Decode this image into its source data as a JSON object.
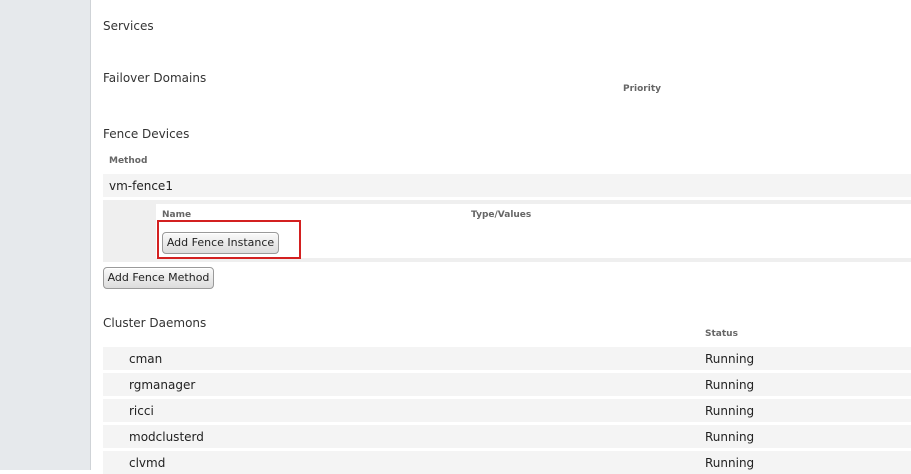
{
  "sections": {
    "services": "Services",
    "failover_domains": "Failover Domains",
    "failover_priority_header": "Priority",
    "fence_devices": "Fence Devices",
    "cluster_daemons": "Cluster Daemons"
  },
  "fence": {
    "method_header": "Method",
    "method_name": "vm-fence1",
    "name_header": "Name",
    "type_values_header": "Type/Values",
    "add_instance_label": "Add Fence Instance",
    "add_method_label": "Add Fence Method"
  },
  "daemons": {
    "status_header": "Status",
    "rows": [
      {
        "name": "cman",
        "status": "Running"
      },
      {
        "name": "rgmanager",
        "status": "Running"
      },
      {
        "name": "ricci",
        "status": "Running"
      },
      {
        "name": "modclusterd",
        "status": "Running"
      },
      {
        "name": "clvmd",
        "status": "Running"
      }
    ]
  },
  "colors": {
    "highlight": "#d32020",
    "sidebar": "#e6e9ec",
    "row_band": "#f4f4f4"
  }
}
